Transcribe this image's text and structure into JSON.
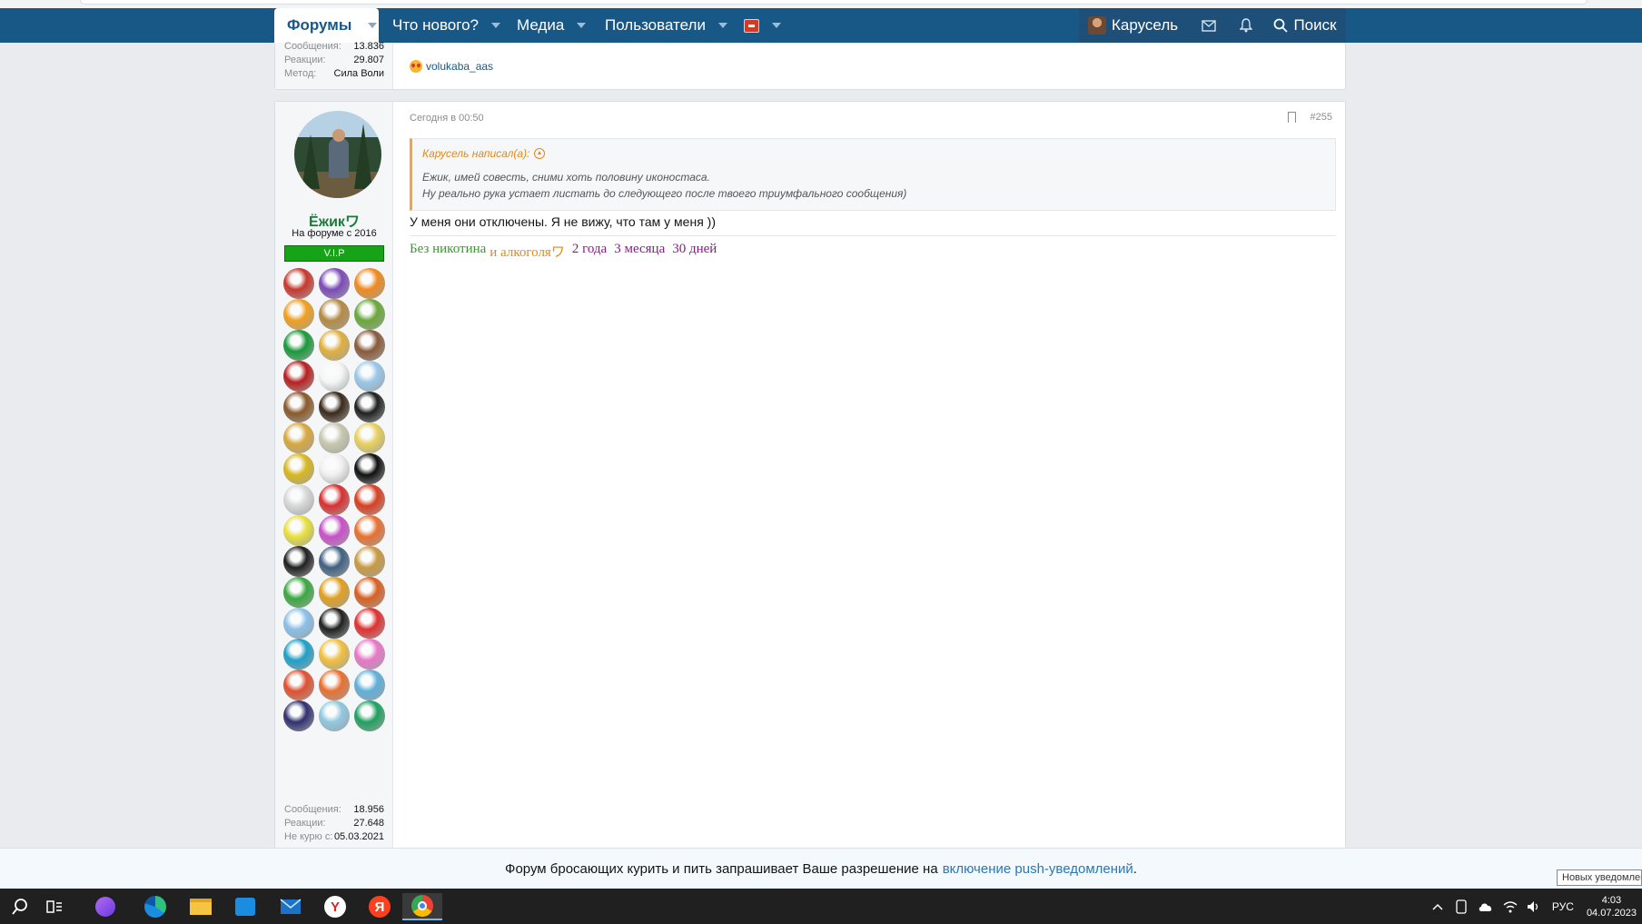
{
  "nav": {
    "tabs": [
      {
        "label": "Форумы",
        "active": true
      },
      {
        "label": "Что нового?"
      },
      {
        "label": "Медиа"
      },
      {
        "label": "Пользователи"
      }
    ],
    "user": "Карусель",
    "search": "Поиск"
  },
  "prev_post": {
    "stats": [
      {
        "label": "Сообщения:",
        "value": "13.836"
      },
      {
        "label": "Реакции:",
        "value": "29.807"
      },
      {
        "label": "Метод:",
        "value": "Сила Воли"
      }
    ],
    "reaction_user": "volukaba_aas"
  },
  "post": {
    "username": "Ёжикワ",
    "since": "На форуме с 2016",
    "rank": "V.I.P",
    "date": "Сегодня в 00:50",
    "number": "#255",
    "quote_author": "Карусель написал(а):",
    "quote_lines": [
      "Ежик, имей совесть, сними хоть половину иконостаса.",
      "Ну реально рука устает листать до следующего после твоего триумфального сообщения)"
    ],
    "text": "У меня они отключены. Я не вижу, что там у меня ))",
    "signature": [
      {
        "text": "Без никотина",
        "color": "#3a9a2c"
      },
      {
        "text": "и алкоголяワ",
        "color": "#e38a17"
      },
      {
        "text": "2 года",
        "color": "#8a1a8a"
      },
      {
        "text": "3 месяца",
        "color": "#8a1a8a"
      },
      {
        "text": "30 дней",
        "color": "#8a1a8a"
      }
    ],
    "stats": [
      {
        "label": "Сообщения:",
        "value": "18.956"
      },
      {
        "label": "Реакции:",
        "value": "27.648"
      },
      {
        "label": "Не курю с:",
        "value": "05.03.2021"
      }
    ],
    "badges": [
      "#c8382e",
      "#7b4bb8",
      "#f08a1e",
      "#f0a020",
      "#b58a44",
      "#6aa83a",
      "#1a9a3a",
      "#e0b040",
      "#8a5a3a",
      "#b82020",
      "#f5f5f5",
      "#9ac8e8",
      "#8a5a2a",
      "#3a2a1a",
      "#202020",
      "#d8a840",
      "#c8c8b0",
      "#e8d060",
      "#d8b820",
      "#f0f0f0",
      "#101010",
      "#d8d8d8",
      "#d83030",
      "#d84020",
      "#e8e040",
      "#c850c8",
      "#e87030",
      "#202020",
      "#406080",
      "#c89a40",
      "#3aa840",
      "#e0a020",
      "#d86020",
      "#8ac0e8",
      "#202020",
      "#e03030",
      "#20a0c8",
      "#f0c040",
      "#e878c8",
      "#e05030",
      "#e87030",
      "#60b0d8",
      "#303070",
      "#90c8e0",
      "#20a060"
    ]
  },
  "push": {
    "text": "Форум бросающих курить и пить запрашивает Ваше разрешение на",
    "link": "включение push-уведомлений",
    "tail": "."
  },
  "toast": "Новых уведомлений",
  "tray": {
    "lang": "РУС",
    "time": "4:03",
    "date": "04.07.2023"
  }
}
